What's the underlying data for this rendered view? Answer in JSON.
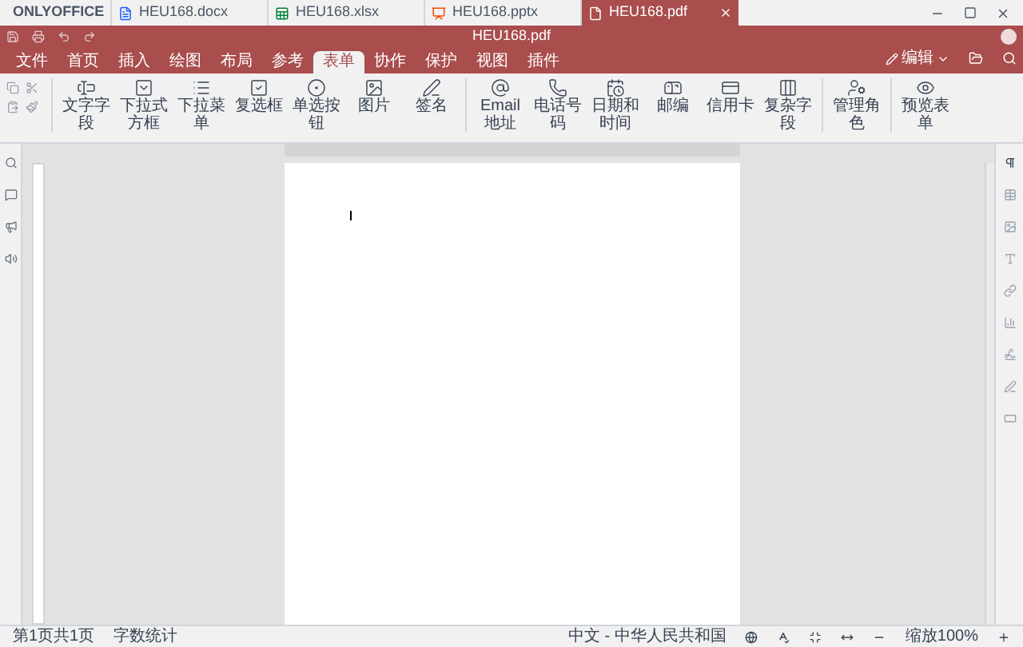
{
  "app_tabs": [
    {
      "label": "ONLYOFFICE",
      "kind": "home",
      "selected": false
    },
    {
      "label": "HEU168.docx",
      "kind": "docx",
      "selected": false
    },
    {
      "label": "HEU168.xlsx",
      "kind": "xlsx",
      "selected": false
    },
    {
      "label": "HEU168.pptx",
      "kind": "pptx",
      "selected": false
    },
    {
      "label": "HEU168.pdf",
      "kind": "pdf",
      "selected": true
    }
  ],
  "window": {
    "title": "HEU168.pdf"
  },
  "edit_button": "编辑",
  "menu_tabs": [
    {
      "label": "文件",
      "selected": false
    },
    {
      "label": "首页",
      "selected": false
    },
    {
      "label": "插入",
      "selected": false
    },
    {
      "label": "绘图",
      "selected": false
    },
    {
      "label": "布局",
      "selected": false
    },
    {
      "label": "参考",
      "selected": false
    },
    {
      "label": "表单",
      "selected": true
    },
    {
      "label": "协作",
      "selected": false
    },
    {
      "label": "保护",
      "selected": false
    },
    {
      "label": "视图",
      "selected": false
    },
    {
      "label": "插件",
      "selected": false
    }
  ],
  "toolbar_groups": [
    [
      "文字字段",
      "下拉式方框",
      "下拉菜单",
      "复选框",
      "单选按钮",
      "图片",
      "签名"
    ],
    [
      "Email地址",
      "电话号码",
      "日期和时间",
      "邮编",
      "信用卡",
      "复杂字段"
    ],
    [
      "管理角色"
    ],
    [
      "预览表单"
    ]
  ],
  "status_bar": {
    "page": "第1页共1页",
    "word_count": "字数统计",
    "language": "中文 - 中华人民共和国",
    "zoom": "缩放100%"
  }
}
